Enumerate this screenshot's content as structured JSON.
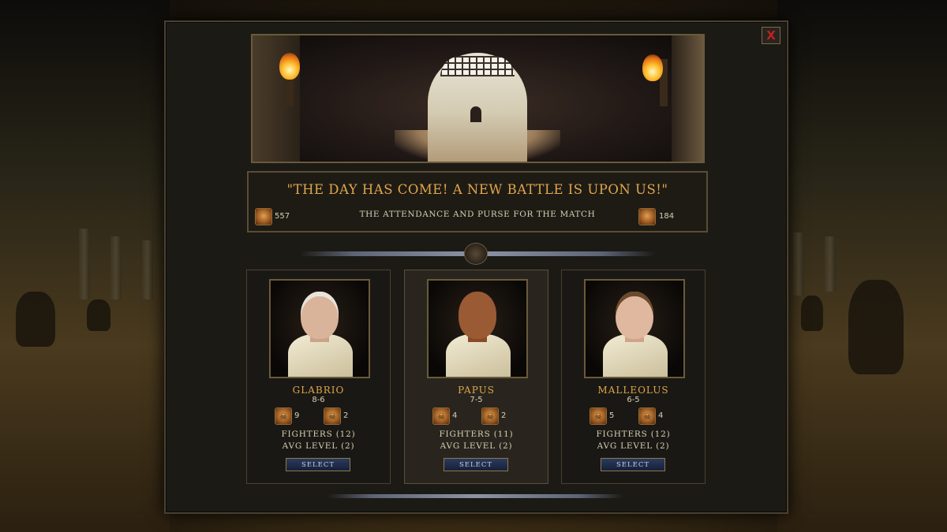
{
  "close_button": {
    "label": "X"
  },
  "header": {
    "quote": "\"THE DAY HAS COME! A NEW BATTLE IS UPON US!\"",
    "purse_label": "THE ATTENDANCE AND PURSE FOR THE MATCH",
    "attendance": "557",
    "purse": "184"
  },
  "fighters": [
    {
      "name": "GLABRIO",
      "record": "8-6",
      "stat_a": "9",
      "stat_b": "2",
      "fighters": "FIGHTERS (12)",
      "avg_level": "AVG LEVEL (2)",
      "select": "SELECT",
      "skin": "#d9b49a",
      "hair": "#e8e4dc"
    },
    {
      "name": "PAPUS",
      "record": "7-5",
      "stat_a": "4",
      "stat_b": "2",
      "fighters": "FIGHTERS (11)",
      "avg_level": "AVG LEVEL (2)",
      "select": "SELECT",
      "skin": "#9a5a34",
      "hair": "#9a5a34"
    },
    {
      "name": "MALLEOLUS",
      "record": "6-5",
      "stat_a": "5",
      "stat_b": "4",
      "fighters": "FIGHTERS (12)",
      "avg_level": "AVG LEVEL (2)",
      "select": "SELECT",
      "skin": "#e0b8a0",
      "hair": "#6a4a2a"
    }
  ],
  "colors": {
    "accent_gold": "#e0a64a",
    "select_blue": "#2c3a5c",
    "close_red": "#c22020"
  }
}
